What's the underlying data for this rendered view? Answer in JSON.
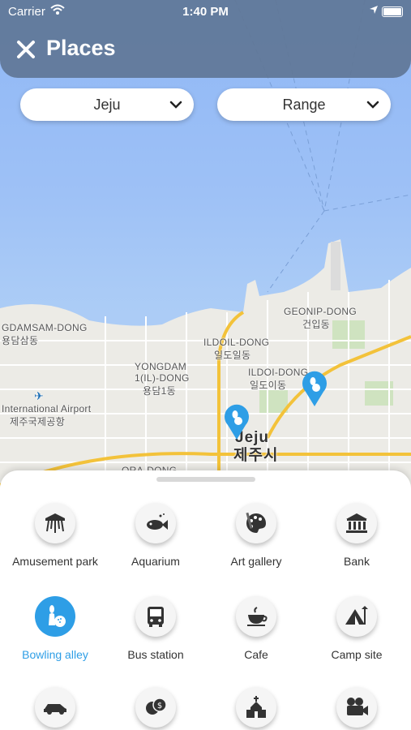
{
  "status_bar": {
    "carrier": "Carrier",
    "time": "1:40 PM"
  },
  "header": {
    "title": "Places",
    "close_icon": "close-icon"
  },
  "filters": {
    "city": "Jeju",
    "range": "Range"
  },
  "map": {
    "labels": {
      "gdamsam": "GDAMSAM-DONG",
      "gdamsam_kr": "용담삼동",
      "yongdam": "YONGDAM",
      "yongdam2": "1(IL)-DONG",
      "yongdam_kr": "용담1동",
      "ildoil": "ILDOIL-DONG",
      "ildoil_kr": "일도일동",
      "ildoi": "ILDOI-DONG",
      "ildoi_kr": "일도이동",
      "geonip": "GEONIP-DONG",
      "geonip_kr": "건입동",
      "airport": "International Airport",
      "airport_kr": "제주국제공항",
      "jeju": "Jeju",
      "jeju_kr": "제주시",
      "ora": "ORA-DONG"
    },
    "colors": {
      "sea": "#9ec1f6",
      "land": "#ecebe6",
      "road": "#f3c23a",
      "pin": "#2e9ee6"
    }
  },
  "categories": [
    {
      "label": "Amusement park",
      "icon": "carousel-icon",
      "selected": false
    },
    {
      "label": "Aquarium",
      "icon": "fish-icon",
      "selected": false
    },
    {
      "label": "Art gallery",
      "icon": "palette-icon",
      "selected": false
    },
    {
      "label": "Bank",
      "icon": "bank-icon",
      "selected": false
    },
    {
      "label": "Bowling alley",
      "icon": "bowling-icon",
      "selected": true
    },
    {
      "label": "Bus station",
      "icon": "bus-icon",
      "selected": false
    },
    {
      "label": "Cafe",
      "icon": "coffee-cup-icon",
      "selected": false
    },
    {
      "label": "Camp site",
      "icon": "tent-icon",
      "selected": false
    },
    {
      "label": "",
      "icon": "car-icon",
      "selected": false
    },
    {
      "label": "",
      "icon": "casino-chips-icon",
      "selected": false
    },
    {
      "label": "",
      "icon": "church-icon",
      "selected": false
    },
    {
      "label": "",
      "icon": "movie-camera-icon",
      "selected": false
    }
  ]
}
